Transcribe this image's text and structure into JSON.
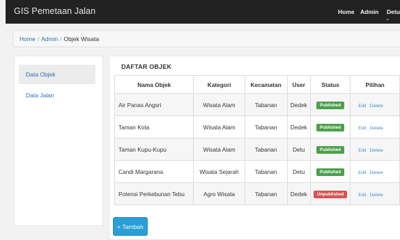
{
  "navbar": {
    "brand": "GIS Pemetaan Jalan",
    "links": [
      "Home",
      "Admin",
      "Detu -"
    ]
  },
  "breadcrumb": {
    "items": [
      "Home",
      "Admin",
      "Objek Wisata"
    ],
    "separator": "/"
  },
  "sidebar": {
    "items": [
      {
        "label": "Data Objek",
        "active": true
      },
      {
        "label": "Data Jalan",
        "active": false
      }
    ]
  },
  "panel": {
    "title": "DAFTAR OBJEK",
    "columns": [
      "Nama Objek",
      "Kategori",
      "Kecamatan",
      "User",
      "Status",
      "Pilihan"
    ],
    "rows": [
      {
        "nama": "Air Panas Angsri",
        "kategori": "Wisata Alam",
        "kecamatan": "Tabanan",
        "user": "Dedek",
        "status": "Published",
        "edit": "Edit",
        "delete": "Delete"
      },
      {
        "nama": "Taman Kota",
        "kategori": "Wisata Alam",
        "kecamatan": "Tabanan",
        "user": "Dedek",
        "status": "Published",
        "edit": "Edit",
        "delete": "Delete"
      },
      {
        "nama": "Taman Kupu-Kupu",
        "kategori": "Wisata Alam",
        "kecamatan": "Tabanan",
        "user": "Detu",
        "status": "Published",
        "edit": "Edit",
        "delete": "Delete"
      },
      {
        "nama": "Candi Margarana",
        "kategori": "Wisata Sejarah",
        "kecamatan": "Tabanan",
        "user": "Detu",
        "status": "Published",
        "edit": "Edit",
        "delete": "Delete"
      },
      {
        "nama": "Potensi Perkebunan Tebu",
        "kategori": "Agro Wisata",
        "kecamatan": "Tabanan",
        "user": "Dedek",
        "status": "Unpublished",
        "edit": "Edit",
        "delete": "Delete"
      }
    ]
  },
  "add_button": "+ Tambah",
  "colors": {
    "navbar": "#222222",
    "link": "#2a6db3",
    "published": "#4c9f4c",
    "unpublished": "#d9534f",
    "primary_button": "#2a9fd6"
  }
}
